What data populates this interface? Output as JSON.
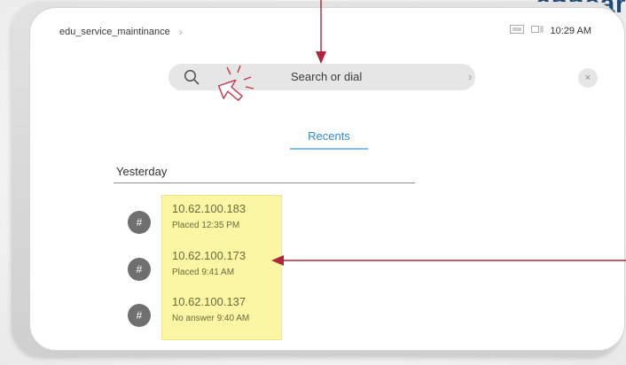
{
  "caption": {
    "text": "appear"
  },
  "status_bar": {
    "title": "edu_service_maintinance",
    "time": "10:29 AM"
  },
  "search": {
    "placeholder": "Search or dial",
    "icon": "magnifier-icon"
  },
  "tabs": [
    {
      "label": "Recents",
      "active": true
    }
  ],
  "section": {
    "label": "Yesterday"
  },
  "calls": [
    {
      "number": "10.62.100.183",
      "status": "Placed 12:35 PM"
    },
    {
      "number": "10.62.100.173",
      "status": "Placed 9:41 AM"
    },
    {
      "number": "10.62.100.137",
      "status": "No answer 9:40 AM"
    }
  ],
  "icons": {
    "avatar_glyph": "#",
    "close_glyph": "×",
    "chevron_glyph": "›"
  },
  "colors": {
    "accent_blue": "#2a8bd4",
    "highlight_yellow": "#fbf6a4",
    "annotation_red": "#b0253d",
    "caption_navy": "#1f4d78"
  }
}
